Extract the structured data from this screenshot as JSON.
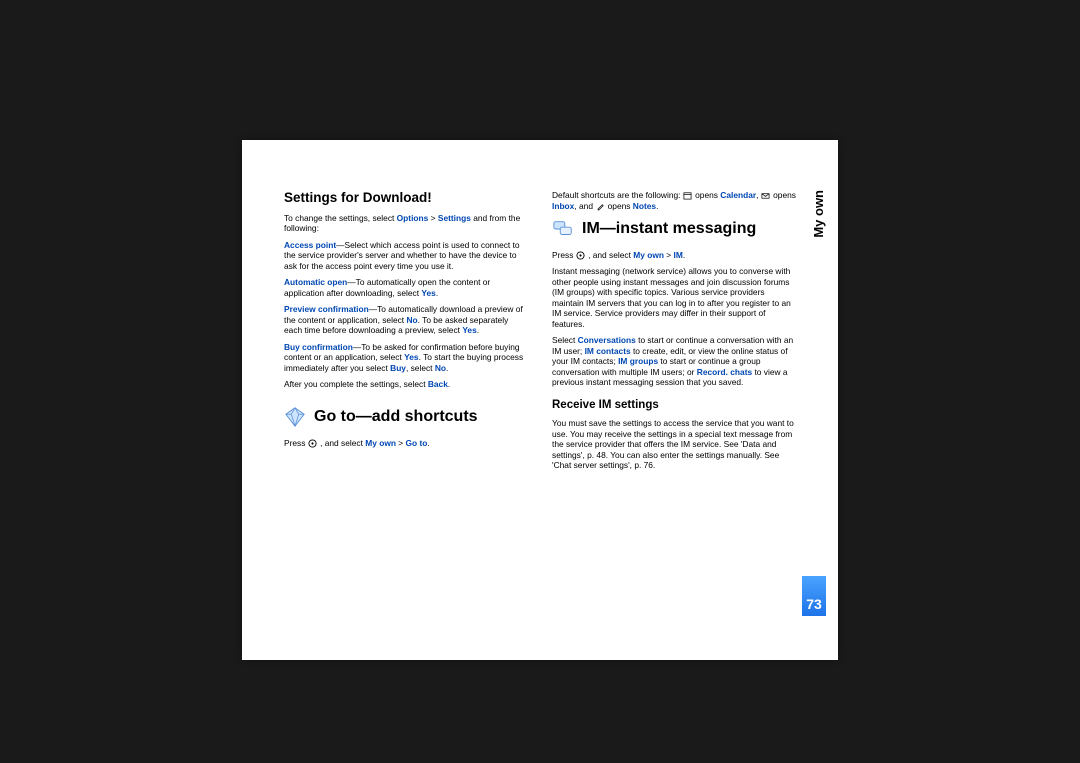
{
  "sideTab": "My own",
  "pageNumber": "73",
  "left": {
    "h2": "Settings for Download!",
    "p1a": "To change the settings, select ",
    "p1b": "Options",
    "p1c": " > ",
    "p1d": "Settings",
    "p1e": " and from the following:",
    "p2a": "Access point",
    "p2b": "—Select which access point is used to connect to the service provider's server and whether to have the device to ask for the access point every time you use it.",
    "p3a": "Automatic open",
    "p3b": "—To automatically open the content or application after downloading, select ",
    "p3c": "Yes",
    "p3d": ".",
    "p4a": "Preview confirmation",
    "p4b": "—To automatically download a preview of the content or application, select ",
    "p4c": "No",
    "p4d": ". To be asked separately each time before downloading a preview, select ",
    "p4e": "Yes",
    "p4f": ".",
    "p5a": "Buy confirmation",
    "p5b": "—To be asked for confirmation before buying content or an application, select ",
    "p5c": "Yes",
    "p5d": ". To start the buying process immediately after you select ",
    "p5e": "Buy",
    "p5f": ", select ",
    "p5g": "No",
    "p5h": ".",
    "p6a": "After you complete the settings, select ",
    "p6b": "Back",
    "p6c": ".",
    "bigHeading1": "Go to—add shortcuts",
    "p7a": "Press ",
    "p7b": " , and select ",
    "p7c": "My own",
    "p7d": " > ",
    "p7e": "Go to",
    "p7f": "."
  },
  "right": {
    "p1a": "Default shortcuts are the following: ",
    "p1b": " opens ",
    "p1c": "Calendar",
    "p1d": ", ",
    "p1e": " opens ",
    "p1f": "Inbox",
    "p1g": ", and ",
    "p1h": " opens ",
    "p1i": "Notes",
    "p1j": ".",
    "bigHeading2": "IM—instant messaging",
    "p2a": "Press ",
    "p2b": " , and select ",
    "p2c": "My own",
    "p2d": " > ",
    "p2e": "IM",
    "p2f": ".",
    "p3": "Instant messaging (network service) allows you to converse with other people using instant messages and join discussion forums (IM groups) with specific topics. Various service providers maintain IM servers that you can log in to after you register to an IM service. Service providers may differ in their support of features.",
    "p4a": "Select ",
    "p4b": "Conversations",
    "p4c": " to start or continue a conversation with an IM user; ",
    "p4d": "IM contacts",
    "p4e": " to create, edit, or view the online status of your IM contacts; ",
    "p4f": "IM groups",
    "p4g": " to start or continue a group conversation with multiple IM users; or ",
    "p4h": "Record. chats",
    "p4i": " to view a previous instant messaging session that you saved.",
    "h3": "Receive IM settings",
    "p5": "You must save the settings to access the service that you want to use. You may receive the settings in a special text message from the service provider that offers the IM service. See 'Data and settings', p. 48. You can also enter the settings manually. See 'Chat server settings', p. 76."
  }
}
